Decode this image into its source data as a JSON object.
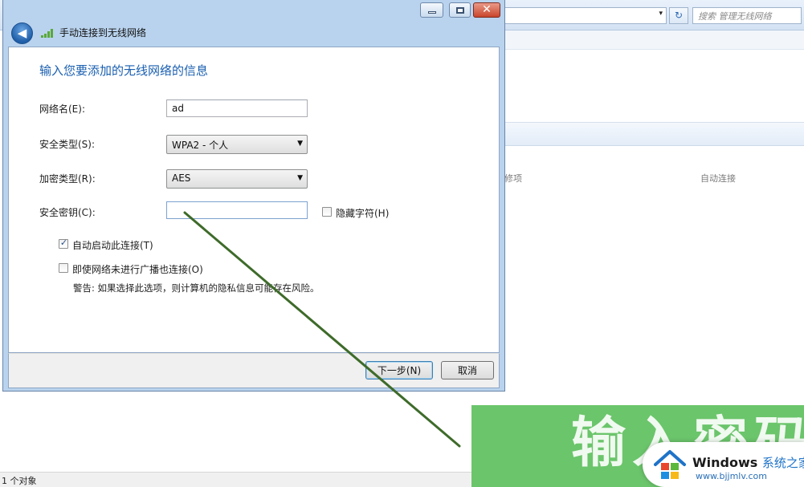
{
  "background": {
    "search_placeholder": "搜索 管理无线网络",
    "address_arrow": "▾",
    "refresh_glyph": "↻",
    "column_modify": "修项",
    "column_auto_connect": "自动连接",
    "status": "1 个对象"
  },
  "dialog": {
    "title": "手动连接到无线网络",
    "back_glyph": "◀",
    "close_glyph": "✕",
    "heading": "输入您要添加的无线网络的信息",
    "network_name": {
      "label": "网络名(E):",
      "value": "ad"
    },
    "security_type": {
      "label": "安全类型(S):",
      "value": "WPA2 - 个人"
    },
    "encryption_type": {
      "label": "加密类型(R):",
      "value": "AES"
    },
    "security_key": {
      "label": "安全密钥(C):",
      "value": ""
    },
    "hide_chars": {
      "label": "隐藏字符(H)",
      "checked": false
    },
    "auto_start": {
      "label": "自动启动此连接(T)",
      "checked": true
    },
    "connect_even_if_not_broadcasting": {
      "label": "即使网络未进行广播也连接(O)",
      "checked": false
    },
    "warning": "警告: 如果选择此选项，则计算机的隐私信息可能存在风险。",
    "next_button": "下一步(N)",
    "cancel_button": "取消",
    "dropdown_arrow": "▼",
    "check_glyph": "✓"
  },
  "banner": {
    "text": "输入密码"
  },
  "watermark": {
    "brand": "Windows",
    "brand_cn": "系统之家",
    "url": "www.bjjmlv.com"
  },
  "colors": {
    "title_blue": "#1a5fb0",
    "banner_green": "#6bc56b",
    "arrow_green": "#3e6b2a"
  }
}
